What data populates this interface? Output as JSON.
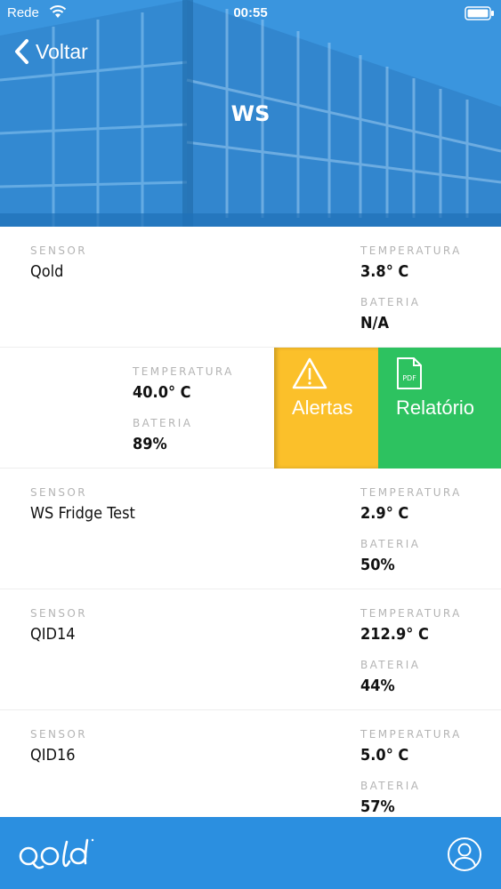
{
  "status_bar": {
    "carrier": "Rede",
    "time": "00:55"
  },
  "header": {
    "back_label": "Voltar",
    "title": "WS"
  },
  "labels": {
    "sensor": "SENSOR",
    "temperature": "TEMPERATURA",
    "battery": "BATERIA"
  },
  "sensors": [
    {
      "name": "Qold",
      "temperature": "3.8° C",
      "battery": "N/A"
    },
    {
      "name": "",
      "temperature": "40.0° C",
      "battery": "89%"
    },
    {
      "name": "WS Fridge Test",
      "temperature": "2.9° C",
      "battery": "50%"
    },
    {
      "name": "QID14",
      "temperature": "212.9° C",
      "battery": "44%"
    },
    {
      "name": "QID16",
      "temperature": "5.0° C",
      "battery": "57%"
    }
  ],
  "swipe_actions": {
    "alerts_label": "Alertas",
    "report_label": "Relatório",
    "pdf_badge": "PDF"
  },
  "colors": {
    "brand": "#2b8fe0",
    "alerts": "#fbc02a",
    "report": "#2dc260",
    "label_gray": "#b4b4b4"
  },
  "footer": {
    "logo_alt": "qold"
  }
}
